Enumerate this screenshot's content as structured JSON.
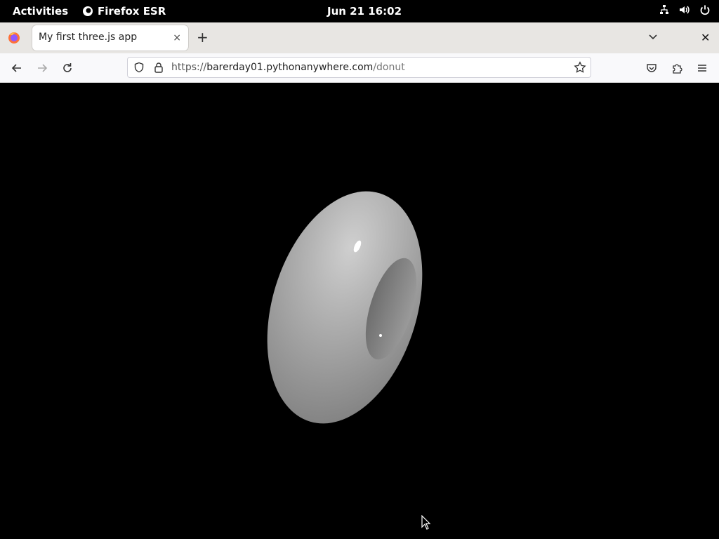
{
  "topbar": {
    "activities": "Activities",
    "app_name": "Firefox ESR",
    "datetime": "Jun 21  16:02"
  },
  "browser": {
    "tab_title": "My first three.js app",
    "tab_close": "×",
    "new_tab": "+",
    "window_close": "✕",
    "url_prefix": "https://",
    "url_host": "barerday01.pythonanywhere.com",
    "url_path": "/donut"
  },
  "icons": {
    "firefox": "firefox-logo-icon",
    "back": "arrow-left-icon",
    "forward": "arrow-right-icon",
    "reload": "reload-icon",
    "shield": "tracking-protection-shield-icon",
    "lock": "lock-icon",
    "star": "bookmark-star-icon",
    "pocket": "pocket-icon",
    "extensions": "puzzle-icon",
    "menu": "hamburger-menu-icon",
    "network": "network-icon",
    "volume": "volume-icon",
    "power": "power-icon"
  },
  "scene": {
    "background": "#000000",
    "object": "torus",
    "color": "#b0b0b0"
  }
}
